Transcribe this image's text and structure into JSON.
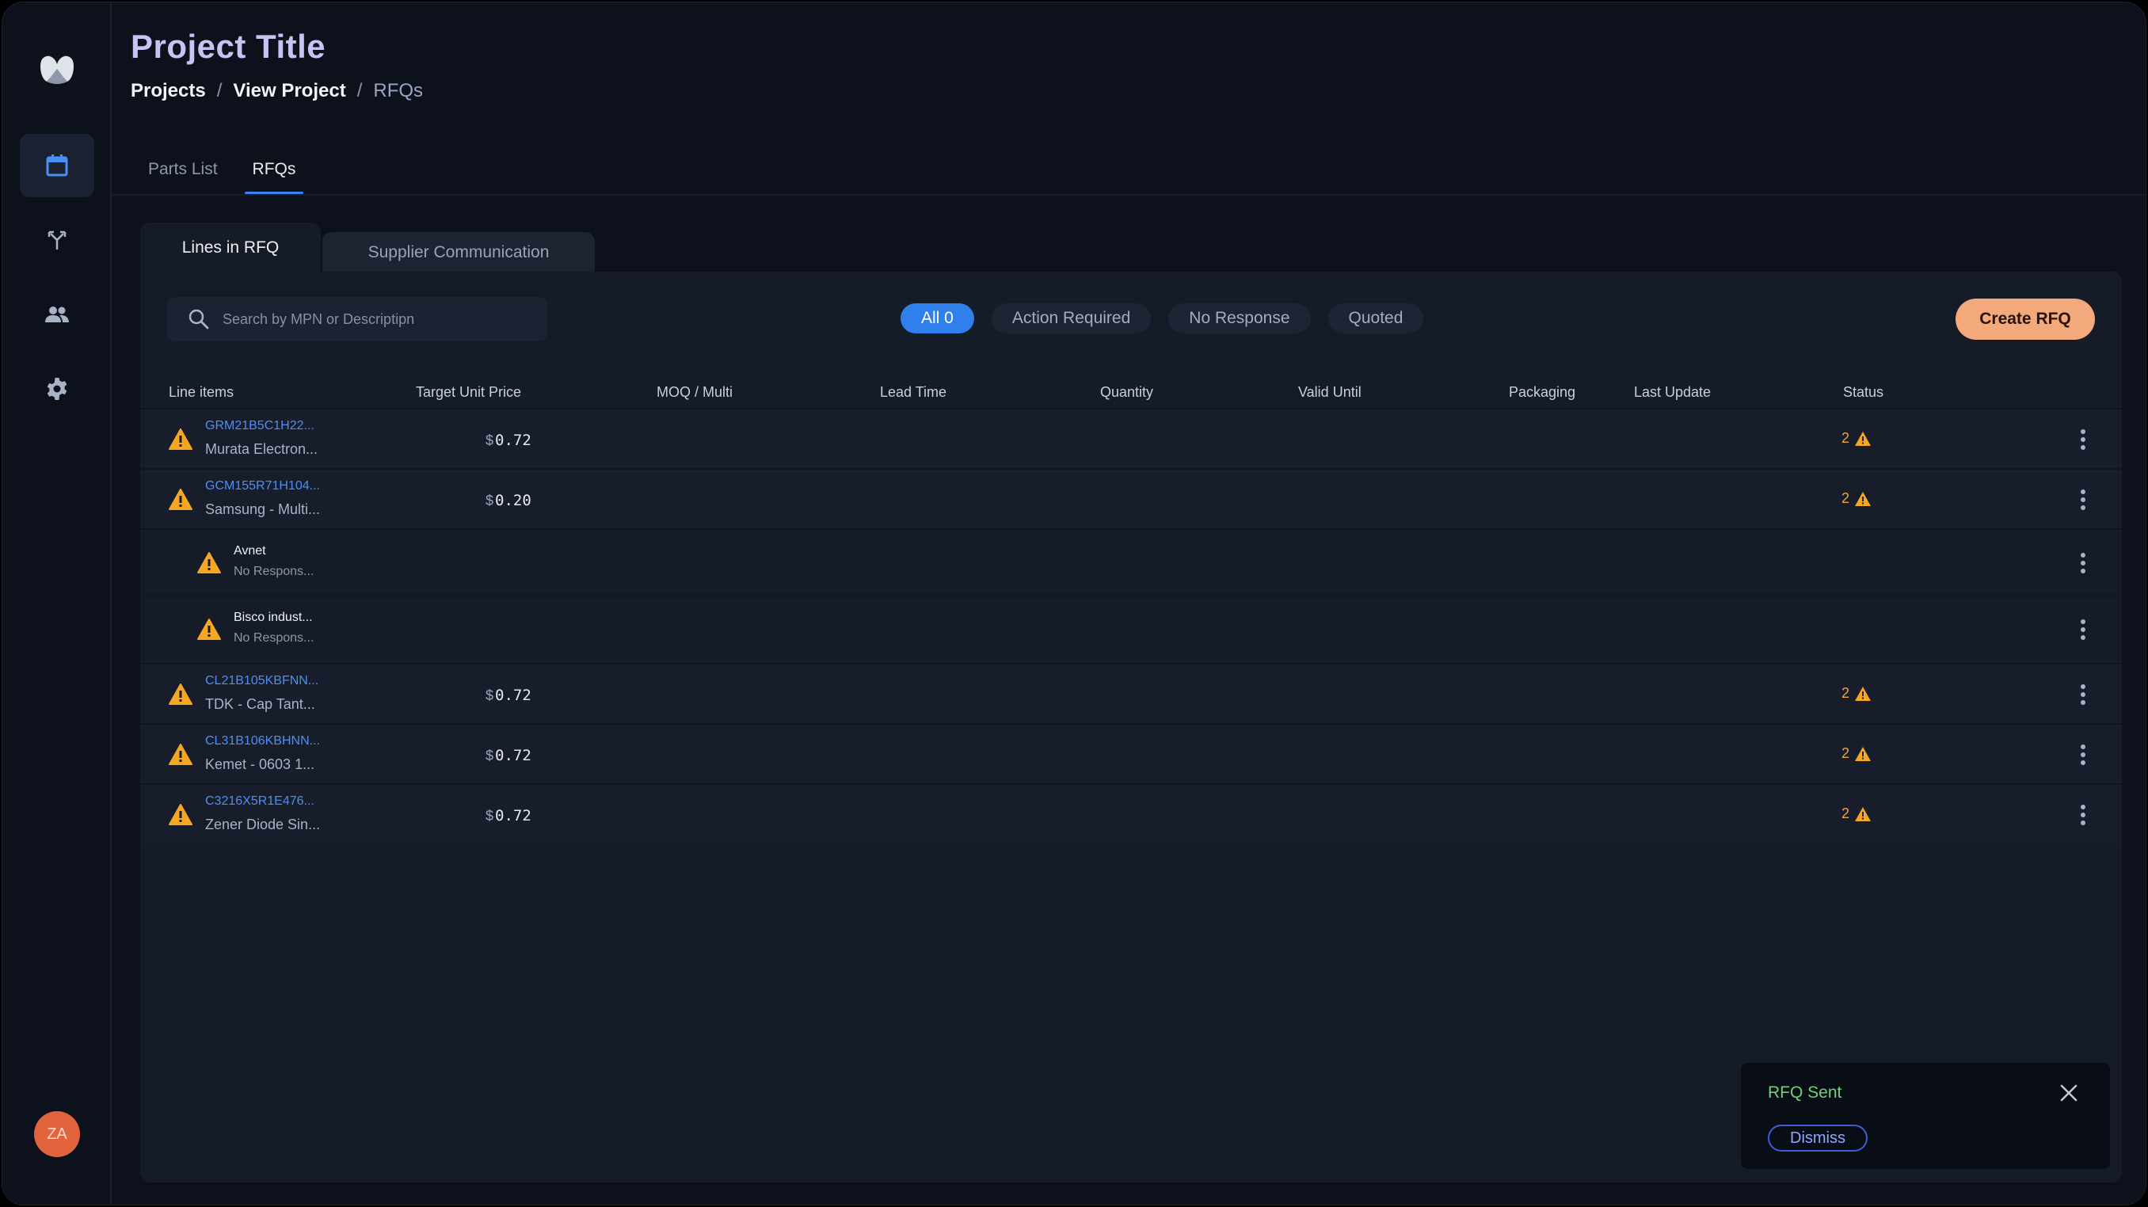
{
  "header": {
    "title": "Project Title",
    "breadcrumb": [
      "Projects",
      "View Project",
      "RFQs"
    ],
    "separator": "/"
  },
  "main_tabs": [
    {
      "label": "Parts List",
      "active": false
    },
    {
      "label": "RFQs",
      "active": true
    }
  ],
  "sub_tabs": [
    {
      "label": "Lines in RFQ",
      "active": true
    },
    {
      "label": "Supplier Communication",
      "active": false
    }
  ],
  "search": {
    "placeholder": "Search by MPN or Descriptipn",
    "value": ""
  },
  "filters": [
    {
      "label": "All 0",
      "active": true
    },
    {
      "label": "Action Required",
      "active": false
    },
    {
      "label": "No Response",
      "active": false
    },
    {
      "label": "Quoted",
      "active": false
    }
  ],
  "create_button": "Create RFQ",
  "table": {
    "columns": [
      "Line items",
      "Target Unit Price",
      "MOQ / Multi",
      "Lead Time",
      "Quantity",
      "Valid Until",
      "Packaging",
      "Last Update",
      "Status"
    ],
    "currency_symbol": "$",
    "rows": [
      {
        "type": "line",
        "mpn": "GRM21B5C1H22...",
        "desc": "Murata Electron...",
        "price": "0.72",
        "status_count": "2"
      },
      {
        "type": "line",
        "mpn": "GCM155R71H104...",
        "desc": "Samsung - Multi...",
        "price": "0.20",
        "status_count": "2"
      },
      {
        "type": "supplier",
        "name": "Avnet",
        "status": "No Respons..."
      },
      {
        "type": "supplier",
        "name": "Bisco indust...",
        "status": "No Respons..."
      },
      {
        "type": "line",
        "mpn": "CL21B105KBFNN...",
        "desc": "TDK - Cap Tant...",
        "price": "0.72",
        "status_count": "2"
      },
      {
        "type": "line",
        "mpn": "CL31B106KBHNN...",
        "desc": "Kemet - 0603 1...",
        "price": "0.72",
        "status_count": "2"
      },
      {
        "type": "line",
        "mpn": "C3216X5R1E476...",
        "desc": "Zener Diode Sin...",
        "price": "0.72",
        "status_count": "2"
      }
    ]
  },
  "toast": {
    "title": "RFQ Sent",
    "dismiss": "Dismiss"
  },
  "user": {
    "initials": "ZA"
  },
  "sidebar": {
    "items": [
      {
        "icon": "calendar-icon",
        "active": true
      },
      {
        "icon": "merge-arrows-icon",
        "active": false
      },
      {
        "icon": "users-icon",
        "active": false
      },
      {
        "icon": "gear-icon",
        "active": false
      }
    ]
  },
  "colors": {
    "background": "#0c111b",
    "panel": "#151b27",
    "accent_blue": "#2f80ed",
    "create_button": "#f4a97d",
    "warning": "#f5a623",
    "toast_title": "#6fd27a",
    "title": "#c8c3f2",
    "avatar": "#e2643c"
  }
}
